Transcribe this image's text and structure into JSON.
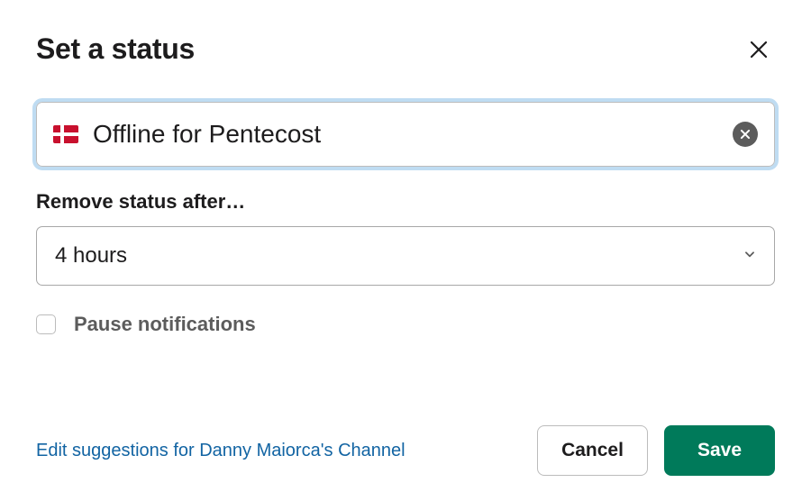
{
  "dialog": {
    "title": "Set a status"
  },
  "status_field": {
    "emoji_name": "flag-denmark",
    "value": "Offline for Pentecost"
  },
  "remove_after": {
    "label": "Remove status after…",
    "selected": "4 hours"
  },
  "pause_notifications": {
    "label": "Pause notifications",
    "checked": false
  },
  "footer": {
    "edit_link": "Edit suggestions for Danny Maiorca's Channel",
    "cancel": "Cancel",
    "save": "Save"
  }
}
